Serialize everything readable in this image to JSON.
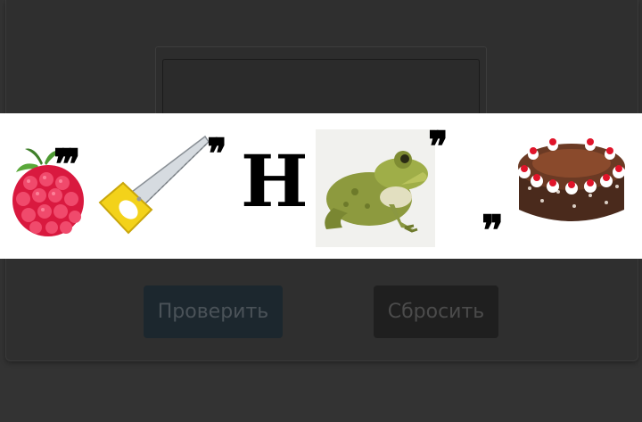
{
  "answer": {
    "value": ""
  },
  "puzzle": {
    "letter": "Н",
    "commas_after_raspberry": "❜❜❜",
    "commas_after_saw": "❜❜",
    "commas_after_frog": "❜❜",
    "comma_before_cake": "❞",
    "pictures": [
      "raspberry-icon",
      "saw-icon",
      "frog-icon",
      "cake-icon"
    ]
  },
  "buttons": {
    "check_label": "Проверить",
    "reset_label": "Сбросить"
  },
  "colors": {
    "background": "#333333",
    "puzzle_background": "#ffffff",
    "check_button": "#1c272e",
    "reset_button": "#1f1f1f"
  }
}
